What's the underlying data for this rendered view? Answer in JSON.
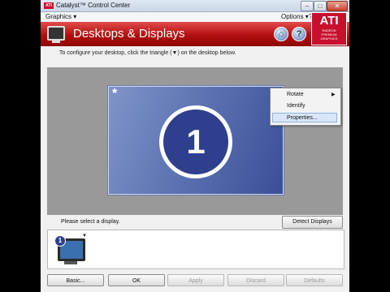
{
  "window": {
    "title": "Catalyst™ Control Center",
    "app_logo_small": "ATI",
    "min_glyph": "–",
    "max_glyph": "□",
    "close_glyph": "✕"
  },
  "menubar": {
    "graphics": "Graphics ▾",
    "options": "Options ▾",
    "help": "?"
  },
  "header": {
    "title": "Desktops & Displays",
    "home_icon": "⌂",
    "help_icon": "?",
    "logo_big": "ATI",
    "logo_line1": "RADEON",
    "logo_line2": "PREMIUM",
    "logo_line3": "GRAPHICS",
    "accent": "#c8102e"
  },
  "instruction": "To configure your desktop, click the triangle (▼) on the desktop below.",
  "desktop": {
    "primary_marker": "*",
    "display_number": "1"
  },
  "context_menu": {
    "items": [
      "Rotate",
      "Identify",
      "Properties..."
    ],
    "submenu_arrow": "▶"
  },
  "status": "Please select a display.",
  "detect_button": "Detect Displays",
  "thumbnail": {
    "number": "1",
    "arrow": "▼"
  },
  "buttons": {
    "basic": "Basic...",
    "ok": "OK",
    "apply": "Apply",
    "discard": "Discard",
    "defaults": "Defaults"
  }
}
